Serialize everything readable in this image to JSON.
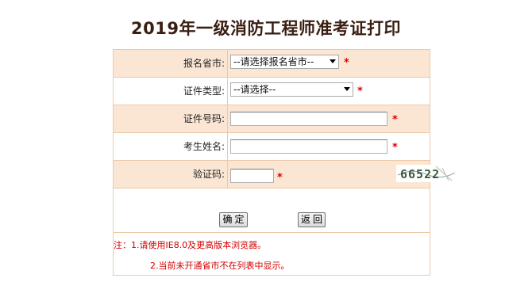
{
  "page": {
    "title": "2019年一级消防工程师准考证打印"
  },
  "form": {
    "province": {
      "label": "报名省市:",
      "value": "--请选择报名省市--"
    },
    "cert_type": {
      "label": "证件类型:",
      "value": "--请选择--"
    },
    "cert_no": {
      "label": "证件号码:",
      "value": ""
    },
    "name": {
      "label": "考生姓名:",
      "value": ""
    },
    "captcha": {
      "label": "验证码:",
      "value": "",
      "image_text": "66522"
    },
    "required_mark": "*"
  },
  "buttons": {
    "confirm": "确定",
    "back": "返回"
  },
  "notes": {
    "line1": "注：1.请使用IE8.0及更高版本浏览器。",
    "line2": "2.当前未开通省市不在列表中显示。"
  },
  "colors": {
    "row_highlight": "#fbe6d4",
    "border": "#ebc9a8",
    "required": "#e00000",
    "title": "#3a1e12"
  }
}
